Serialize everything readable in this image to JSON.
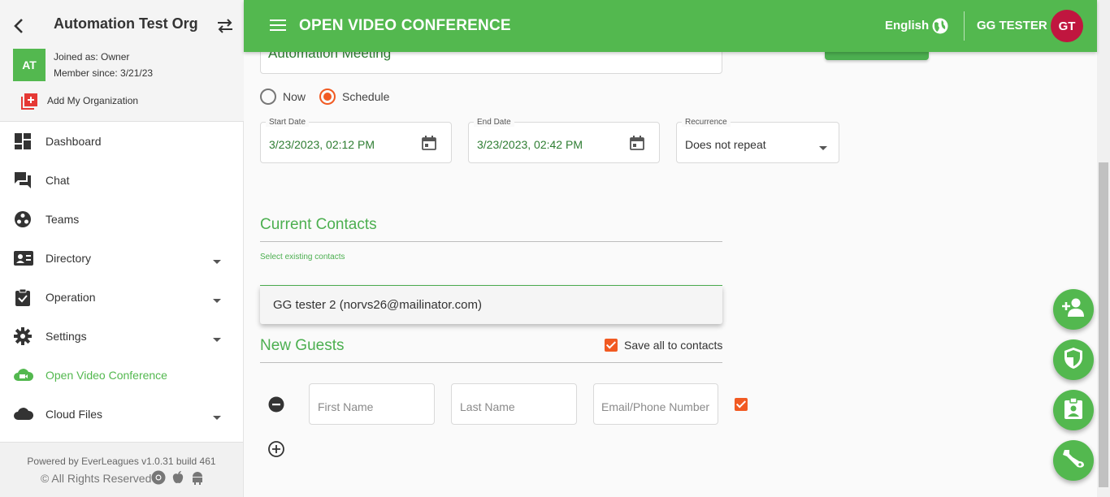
{
  "sidebar": {
    "org_name": "Automation Test Org",
    "avatar_initials": "AT",
    "joined_as": "Joined as: Owner",
    "member_since": "Member since: 3/21/23",
    "add_org": "Add My Organization",
    "items": [
      {
        "label": "Dashboard",
        "icon": "dashboard-icon"
      },
      {
        "label": "Chat",
        "icon": "chat-icon"
      },
      {
        "label": "Teams",
        "icon": "teams-icon"
      },
      {
        "label": "Directory",
        "icon": "directory-icon"
      },
      {
        "label": "Operation",
        "icon": "clipboard-icon"
      },
      {
        "label": "Settings",
        "icon": "gear-icon"
      },
      {
        "label": "Open Video Conference",
        "icon": "video-cloud-icon"
      },
      {
        "label": "Cloud Files",
        "icon": "cloud-icon"
      }
    ],
    "footer_powered": "Powered by EverLeagues v1.0.31 build 461",
    "footer_rights": "© All Rights Reserved"
  },
  "header": {
    "title": "OPEN VIDEO CONFERENCE",
    "language": "English",
    "user_name": "GG TESTER",
    "user_initials": "GT"
  },
  "form": {
    "meeting_name": "Automation Meeting",
    "radio_now": "Now",
    "radio_schedule": "Schedule",
    "selected_mode": "Schedule",
    "start_label": "Start Date",
    "start_value": "3/23/2023, 02:12 PM",
    "end_label": "End Date",
    "end_value": "3/23/2023, 02:42 PM",
    "recurrence_label": "Recurrence",
    "recurrence_value": "Does not repeat"
  },
  "contacts": {
    "title": "Current Contacts",
    "helper": "Select existing contacts",
    "suggestion": "GG tester 2 (norvs26@mailinator.com)"
  },
  "guests": {
    "title": "New Guests",
    "save_all": "Save all to contacts",
    "save_all_checked": true,
    "first_name_ph": "First Name",
    "last_name_ph": "Last Name",
    "email_ph": "Email/Phone Number",
    "row_checked": true
  },
  "colors": {
    "brand_green": "#53b84f",
    "accent_orange": "#f15a22",
    "avatar_red": "#c0163f"
  }
}
